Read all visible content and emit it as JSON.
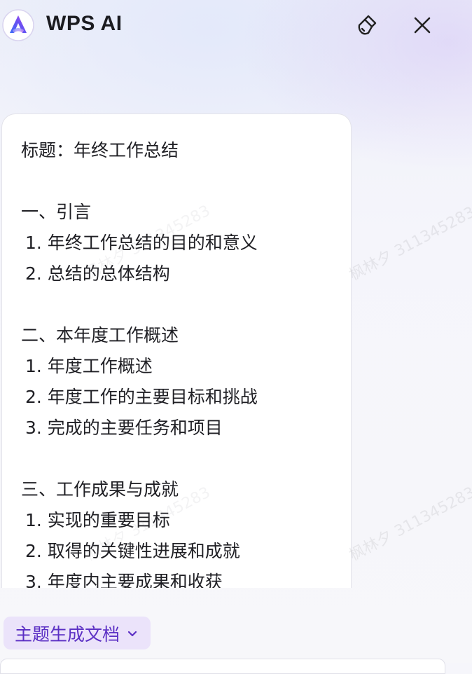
{
  "header": {
    "title": "WPS AI"
  },
  "icons": {
    "logo": "wps-ai-logo",
    "brush": "clear-brush-icon",
    "close": "close-icon",
    "chip_chevron": "chevron-down-icon"
  },
  "content": {
    "title_line": "标题：年终工作总结",
    "sections": [
      {
        "heading": "一、引言",
        "items": [
          "1. 年终工作总结的目的和意义",
          "2. 总结的总体结构"
        ]
      },
      {
        "heading": "二、本年度工作概述",
        "items": [
          "1. 年度工作概述",
          "2. 年度工作的主要目标和挑战",
          "3. 完成的主要任务和项目"
        ]
      },
      {
        "heading": "三、工作成果与成就",
        "items": [
          "1. 实现的重要目标",
          "2. 取得的关键性进展和成就",
          "3. 年度内主要成果和收获"
        ]
      }
    ]
  },
  "watermark": {
    "text": "枫林夕 311345283"
  },
  "topic_selector": {
    "label": "主题生成文档"
  },
  "colors": {
    "accent": "#5b2fc4",
    "chip_bg": "#ebe3fa",
    "logo_blue": "#3b6cf6",
    "logo_purple": "#a64ff0"
  }
}
